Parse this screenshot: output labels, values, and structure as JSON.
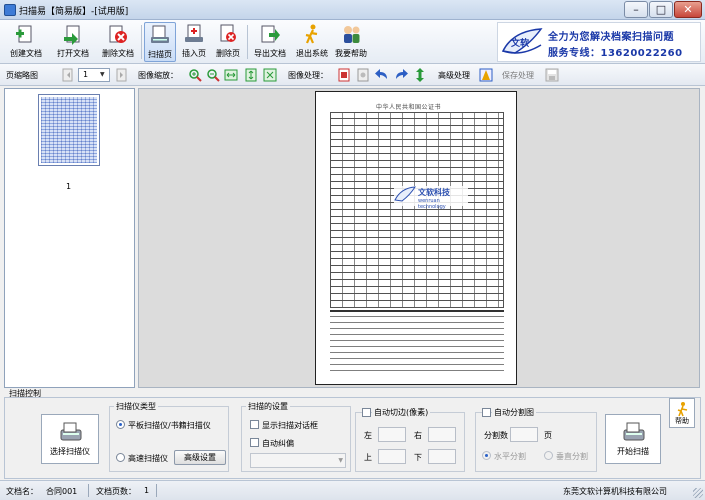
{
  "window": {
    "title": "扫描易【简易版】-[试用版]",
    "controls": {
      "minimize": "–",
      "maximize": "□",
      "close": "✕"
    }
  },
  "toolbar": {
    "buttons": [
      {
        "label": "创建文档",
        "icon": "create-doc-icon"
      },
      {
        "label": "打开文档",
        "icon": "open-doc-icon"
      },
      {
        "label": "删除文档",
        "icon": "delete-doc-icon"
      },
      {
        "label": "扫描页",
        "icon": "scan-page-icon",
        "active": true
      },
      {
        "label": "插入页",
        "icon": "insert-page-icon"
      },
      {
        "label": "删除页",
        "icon": "delete-page-icon"
      },
      {
        "label": "导出文档",
        "icon": "export-doc-icon"
      },
      {
        "label": "退出系统",
        "icon": "exit-icon"
      },
      {
        "label": "我要帮助",
        "icon": "help-icon"
      }
    ]
  },
  "banner": {
    "logo_text": "文软",
    "line1": "全力为您解决档案扫描问题",
    "line2": "服务专线：13620022260"
  },
  "opbar": {
    "thumb_label": "页缩略图",
    "page_value": "1",
    "zoom_label": "图像缩放：",
    "process_label": "图像处理：",
    "advanced_label": "高级处理",
    "save_label": "保存处理"
  },
  "thumbnails": [
    {
      "number": "1"
    }
  ],
  "document": {
    "title": "中华人民共和国公证书",
    "watermark_line1": "文软科技",
    "watermark_line2": "wenruan technology"
  },
  "scan_section": {
    "title": "扫描控制",
    "select_scanner_label": "选择扫描仪",
    "start_scan_label": "开始扫描",
    "help_label": "帮助",
    "scanner_type": {
      "title": "扫描仪类型",
      "option_flatbed": "平板扫描仪/书籍扫描仪",
      "option_highspeed": "高速扫描仪",
      "advanced_button": "高级设置"
    },
    "settings": {
      "title": "扫描的设置",
      "show_dialog_label": "显示扫描对话框",
      "auto_crop_label": "自动纠偏"
    },
    "auto_margin": {
      "title": "自动切边(像素)",
      "left": "左",
      "right": "右",
      "top": "上",
      "bottom": "下"
    },
    "auto_split": {
      "title": "自动分割图",
      "split_count_label": "分割数",
      "page_unit": "页",
      "horizontal": "水平分割",
      "vertical": "垂直分割"
    }
  },
  "status": {
    "doc_name_label": "文档名：",
    "doc_name": "合同001",
    "page_count_label": "文档页数：",
    "page_count": "1",
    "company": "东莞文软计算机科技有限公司"
  }
}
